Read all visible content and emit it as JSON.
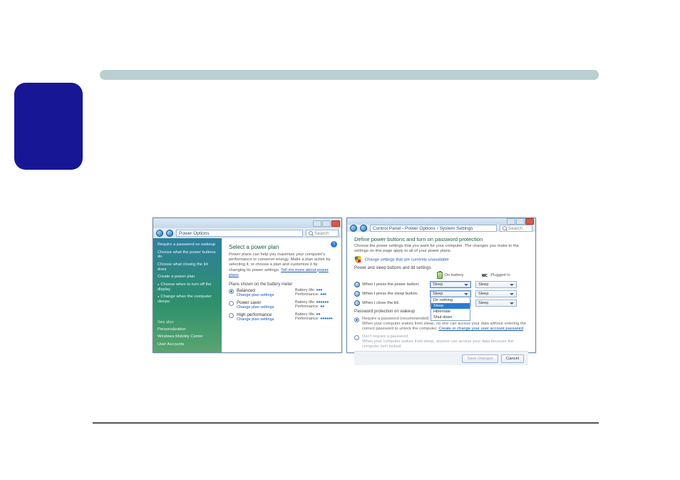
{
  "win1": {
    "address": "Power Options",
    "search_placeholder": "Search",
    "sidebar": {
      "items": [
        "Require a password on wakeup",
        "Choose what the power buttons do",
        "Choose what closing the lid does",
        "Create a power plan",
        "Choose when to turn off the display",
        "Change when the computer sleeps"
      ],
      "see_also_label": "See also",
      "see_also": [
        "Personalization",
        "Windows Mobility Center",
        "User Accounts"
      ]
    },
    "heading": "Select a power plan",
    "description": "Power plans can help you maximize your computer's performance or conserve energy. Make a plan active by selecting it, or choose a plan and customize it by changing its power settings.",
    "desc_link": "Tell me more about power plans",
    "plans_header": "Plans shown on the battery meter",
    "plans": [
      {
        "name": "Balanced",
        "link": "Change plan settings",
        "battery": "Battery life:",
        "battery_dots": "●●●",
        "perf": "Performance:",
        "perf_dots": "●●●",
        "checked": true
      },
      {
        "name": "Power saver",
        "link": "Change plan settings",
        "battery": "Battery life:",
        "battery_dots": "●●●●●●",
        "perf": "Performance:",
        "perf_dots": "●●",
        "checked": false
      },
      {
        "name": "High performance",
        "link": "Change plan settings",
        "battery": "Battery life:",
        "battery_dots": "●●",
        "perf": "Performance:",
        "perf_dots": "●●●●●●",
        "checked": false
      }
    ]
  },
  "win2": {
    "breadcrumb": "Control Panel › Power Options › System Settings",
    "search_placeholder": "Search",
    "heading": "Define power buttons and turn on password protection",
    "sub": "Choose the power settings that you want for your computer. The changes you make to the settings on this page apply to all of your power plans.",
    "shield_link": "Change settings that are currently unavailable",
    "section1": "Power and sleep buttons and lid settings",
    "col_battery": "On battery",
    "col_plugged": "Plugged in",
    "rows": [
      {
        "label": "When I press the power button:",
        "battery": "Sleep",
        "plugged": "Sleep",
        "open": false
      },
      {
        "label": "When I press the sleep button:",
        "battery": "Sleep",
        "plugged": "Sleep",
        "open": true
      },
      {
        "label": "When I close the lid:",
        "battery": "Sleep",
        "plugged": "Sleep",
        "open": false
      }
    ],
    "dd_options": [
      "Do nothing",
      "Sleep",
      "Hibernate",
      "Shut down"
    ],
    "section2": "Password protection on wakeup",
    "pw_opt1_title": "Require a password (recommended)",
    "pw_opt1_body": "When your computer wakes from sleep, no one can access your data without entering the correct password to unlock the computer.",
    "pw_opt1_link": "Create or change your user account password",
    "pw_opt2_title": "Don't require a password",
    "pw_opt2_body": "When your computer wakes from sleep, anyone can access your data because the computer isn't locked.",
    "save_label": "Save changes",
    "cancel_label": "Cancel"
  }
}
